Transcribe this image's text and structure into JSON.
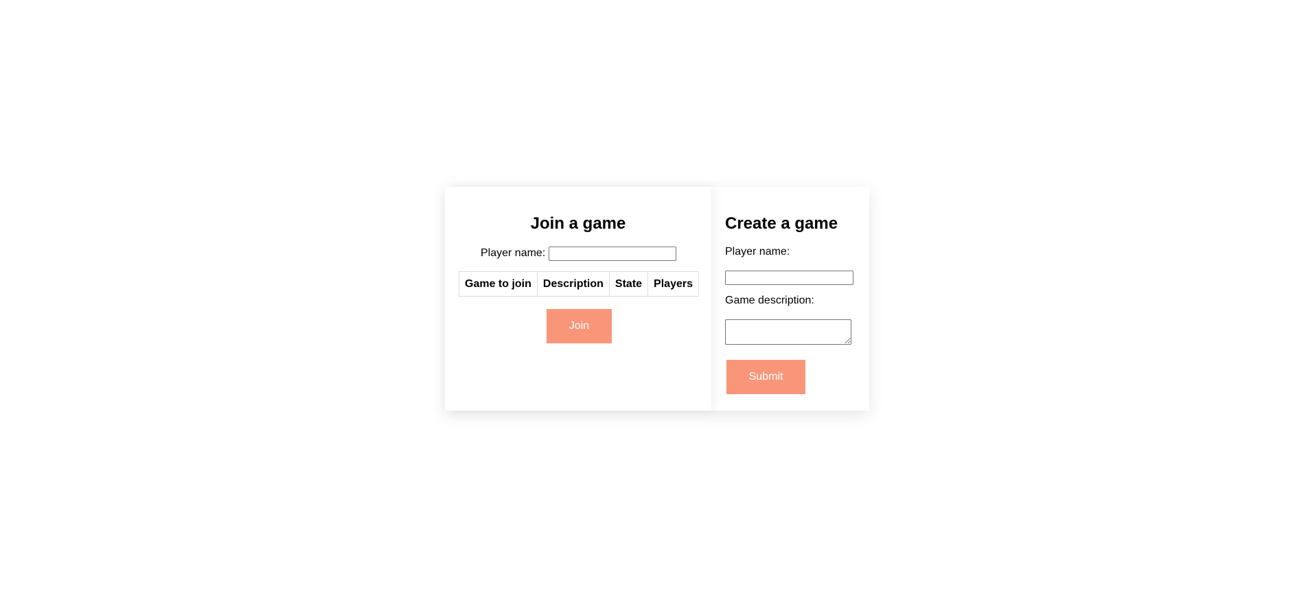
{
  "join": {
    "title": "Join a game",
    "player_name_label": "Player name:",
    "player_name_value": "",
    "table": {
      "columns": [
        "Game to join",
        "Description",
        "State",
        "Players"
      ],
      "rows": []
    },
    "join_button_label": "Join"
  },
  "create": {
    "title": "Create a game",
    "player_name_label": "Player name:",
    "player_name_value": "",
    "game_description_label": "Game description:",
    "game_description_value": "",
    "submit_button_label": "Submit"
  },
  "colors": {
    "button_bg": "#f9967a",
    "button_text": "#ffffff",
    "page_bg": "#ffffff",
    "table_border": "#dddddd"
  }
}
